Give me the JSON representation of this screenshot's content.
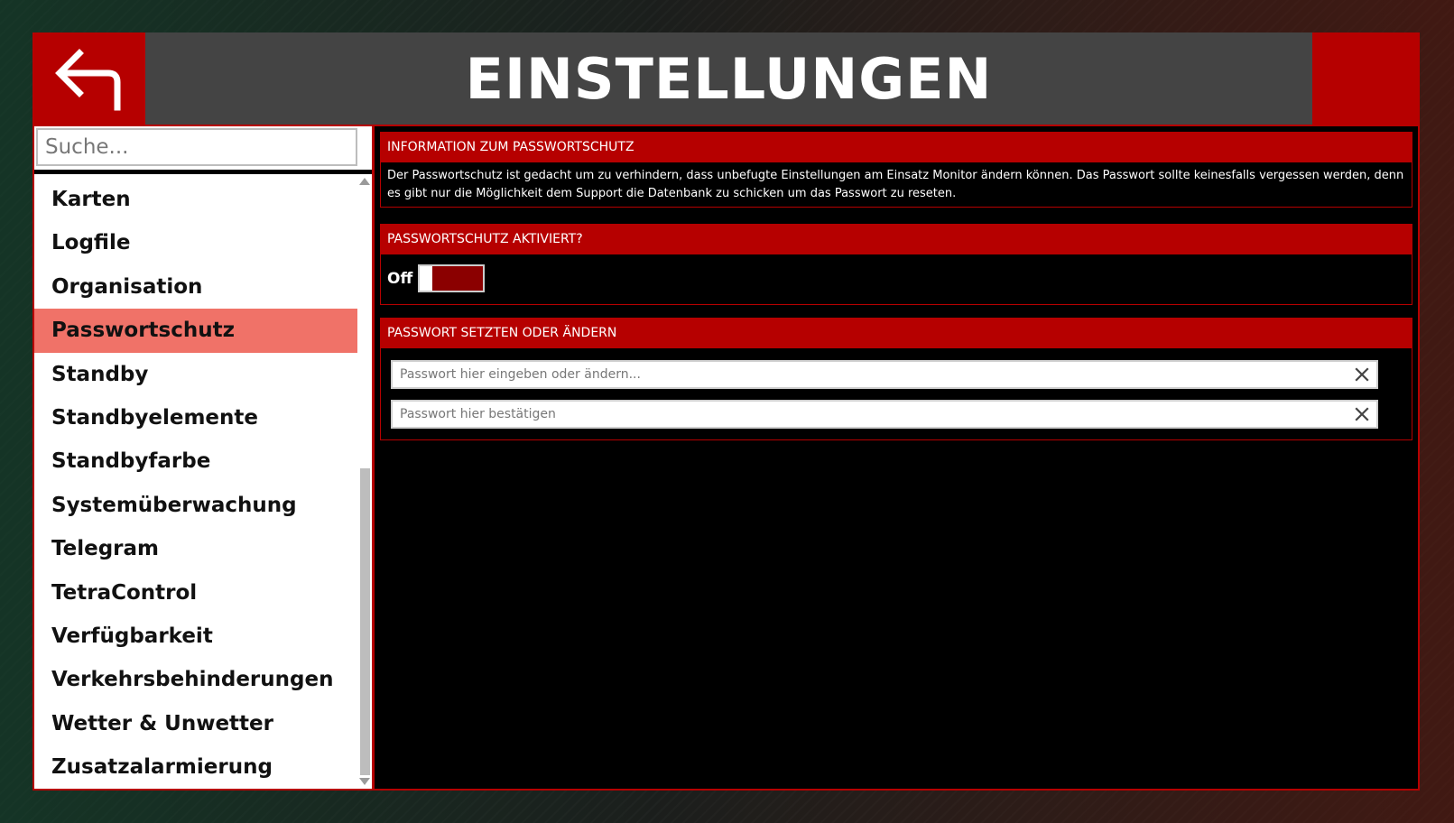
{
  "header": {
    "title": "EINSTELLUNGEN",
    "back_icon": "back-arrow-icon"
  },
  "sidebar": {
    "search_placeholder": "Suche...",
    "items": [
      {
        "label": "Karten",
        "active": false
      },
      {
        "label": "Logfile",
        "active": false
      },
      {
        "label": "Organisation",
        "active": false
      },
      {
        "label": "Passwortschutz",
        "active": true
      },
      {
        "label": "Standby",
        "active": false
      },
      {
        "label": "Standbyelemente",
        "active": false
      },
      {
        "label": "Standbyfarbe",
        "active": false
      },
      {
        "label": "Systemüberwachung",
        "active": false
      },
      {
        "label": "Telegram",
        "active": false
      },
      {
        "label": "TetraControl",
        "active": false
      },
      {
        "label": "Verfügbarkeit",
        "active": false
      },
      {
        "label": "Verkehrsbehinderungen",
        "active": false
      },
      {
        "label": "Wetter & Unwetter",
        "active": false
      },
      {
        "label": "Zusatzalarmierung",
        "active": false
      }
    ]
  },
  "info_panel": {
    "title": "INFORMATION ZUM PASSWORTSCHUTZ",
    "text": "Der Passwortschutz ist gedacht um zu verhindern, dass unbefugte Einstellungen am Einsatz Monitor ändern können. Das Passwort sollte keinesfalls vergessen werden, denn es gibt nur die Möglichkeit dem Support die Datenbank zu schicken um das Passwort zu reseten."
  },
  "toggle_panel": {
    "title": "PASSWORTSCHUTZ AKTIVIERT?",
    "state_label": "Off",
    "enabled": false
  },
  "password_panel": {
    "title": "PASSWORT SETZTEN ODER ÄNDERN",
    "password_placeholder": "Passwort hier eingeben oder ändern...",
    "confirm_placeholder": "Passwort hier bestätigen",
    "password_value": "",
    "confirm_value": "",
    "clear_icon": "close-icon"
  },
  "colors": {
    "accent_red": "#b60000",
    "header_gray": "#444444",
    "active_item": "#f07268",
    "toggle_fill": "#8b0000"
  }
}
